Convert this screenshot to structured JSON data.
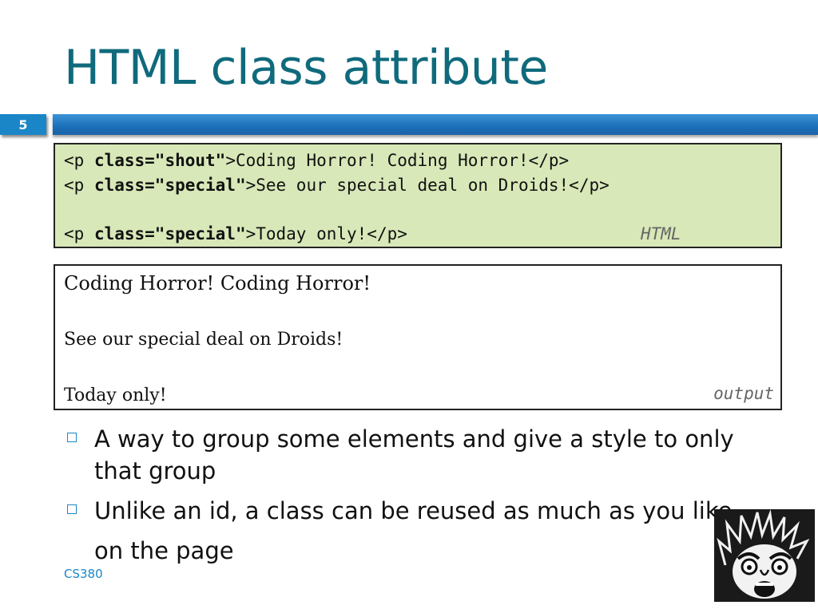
{
  "slide": {
    "title": "HTML class attribute",
    "number": "5",
    "footer": "CS380"
  },
  "code_box": {
    "label": "HTML",
    "lines": [
      {
        "open": "<p ",
        "attr": "class=\"shout\"",
        "close": ">Coding Horror! Coding Horror!</p>"
      },
      {
        "open": "<p ",
        "attr": "class=\"special\"",
        "close": ">See our special deal on Droids!</p>"
      },
      {
        "open": "<p ",
        "attr": "class=\"special\"",
        "close": ">Today only!</p>"
      }
    ]
  },
  "output_box": {
    "label": "output",
    "lines": [
      "Coding Horror! Coding Horror!",
      "See our special deal on Droids!",
      "Today only!"
    ]
  },
  "bullets": [
    "A way to group some elements and give a style to only that group",
    "Unlike an id, a class can be reused as much as you like",
    "on the page"
  ],
  "colors": {
    "title": "#0f6a7c",
    "accent": "#1a86c8",
    "code_bg": "#d8e8b8"
  },
  "image": {
    "icon": "screaming-man-cartoon-icon"
  }
}
